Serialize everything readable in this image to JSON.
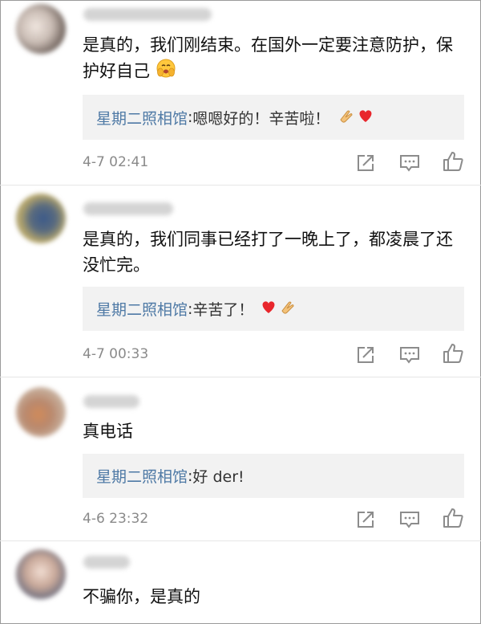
{
  "comments": [
    {
      "text": "是真的，我们刚结束。在国外一定要注意防护，保护好自己",
      "emoji": "smiling-face-with-hands-icon",
      "reply": {
        "author": "星期二照相馆",
        "separator": ": ",
        "text": "嗯嗯好的！辛苦啦！",
        "icons": [
          "clapping-hands-icon",
          "red-heart-icon"
        ]
      },
      "time": "4-7 02:41"
    },
    {
      "text": "是真的，我们同事已经打了一晚上了，都凌晨了还没忙完。",
      "reply": {
        "author": "星期二照相馆",
        "separator": ": ",
        "text": "辛苦了！",
        "icons": [
          "red-heart-icon",
          "clapping-hands-icon"
        ]
      },
      "time": "4-7 00:33"
    },
    {
      "text": "真电话",
      "reply": {
        "author": "星期二照相馆",
        "separator": ": ",
        "text": "好 der!",
        "icons": []
      },
      "time": "4-6 23:32"
    },
    {
      "text": "不骗你，是真的"
    }
  ],
  "actions": [
    "share-icon",
    "comment-icon",
    "like-icon"
  ],
  "colors": {
    "reply_author": "#4e79a5",
    "time": "#8a8a8a",
    "reply_bg": "#f2f2f2",
    "icon": "#8c8c8c"
  }
}
